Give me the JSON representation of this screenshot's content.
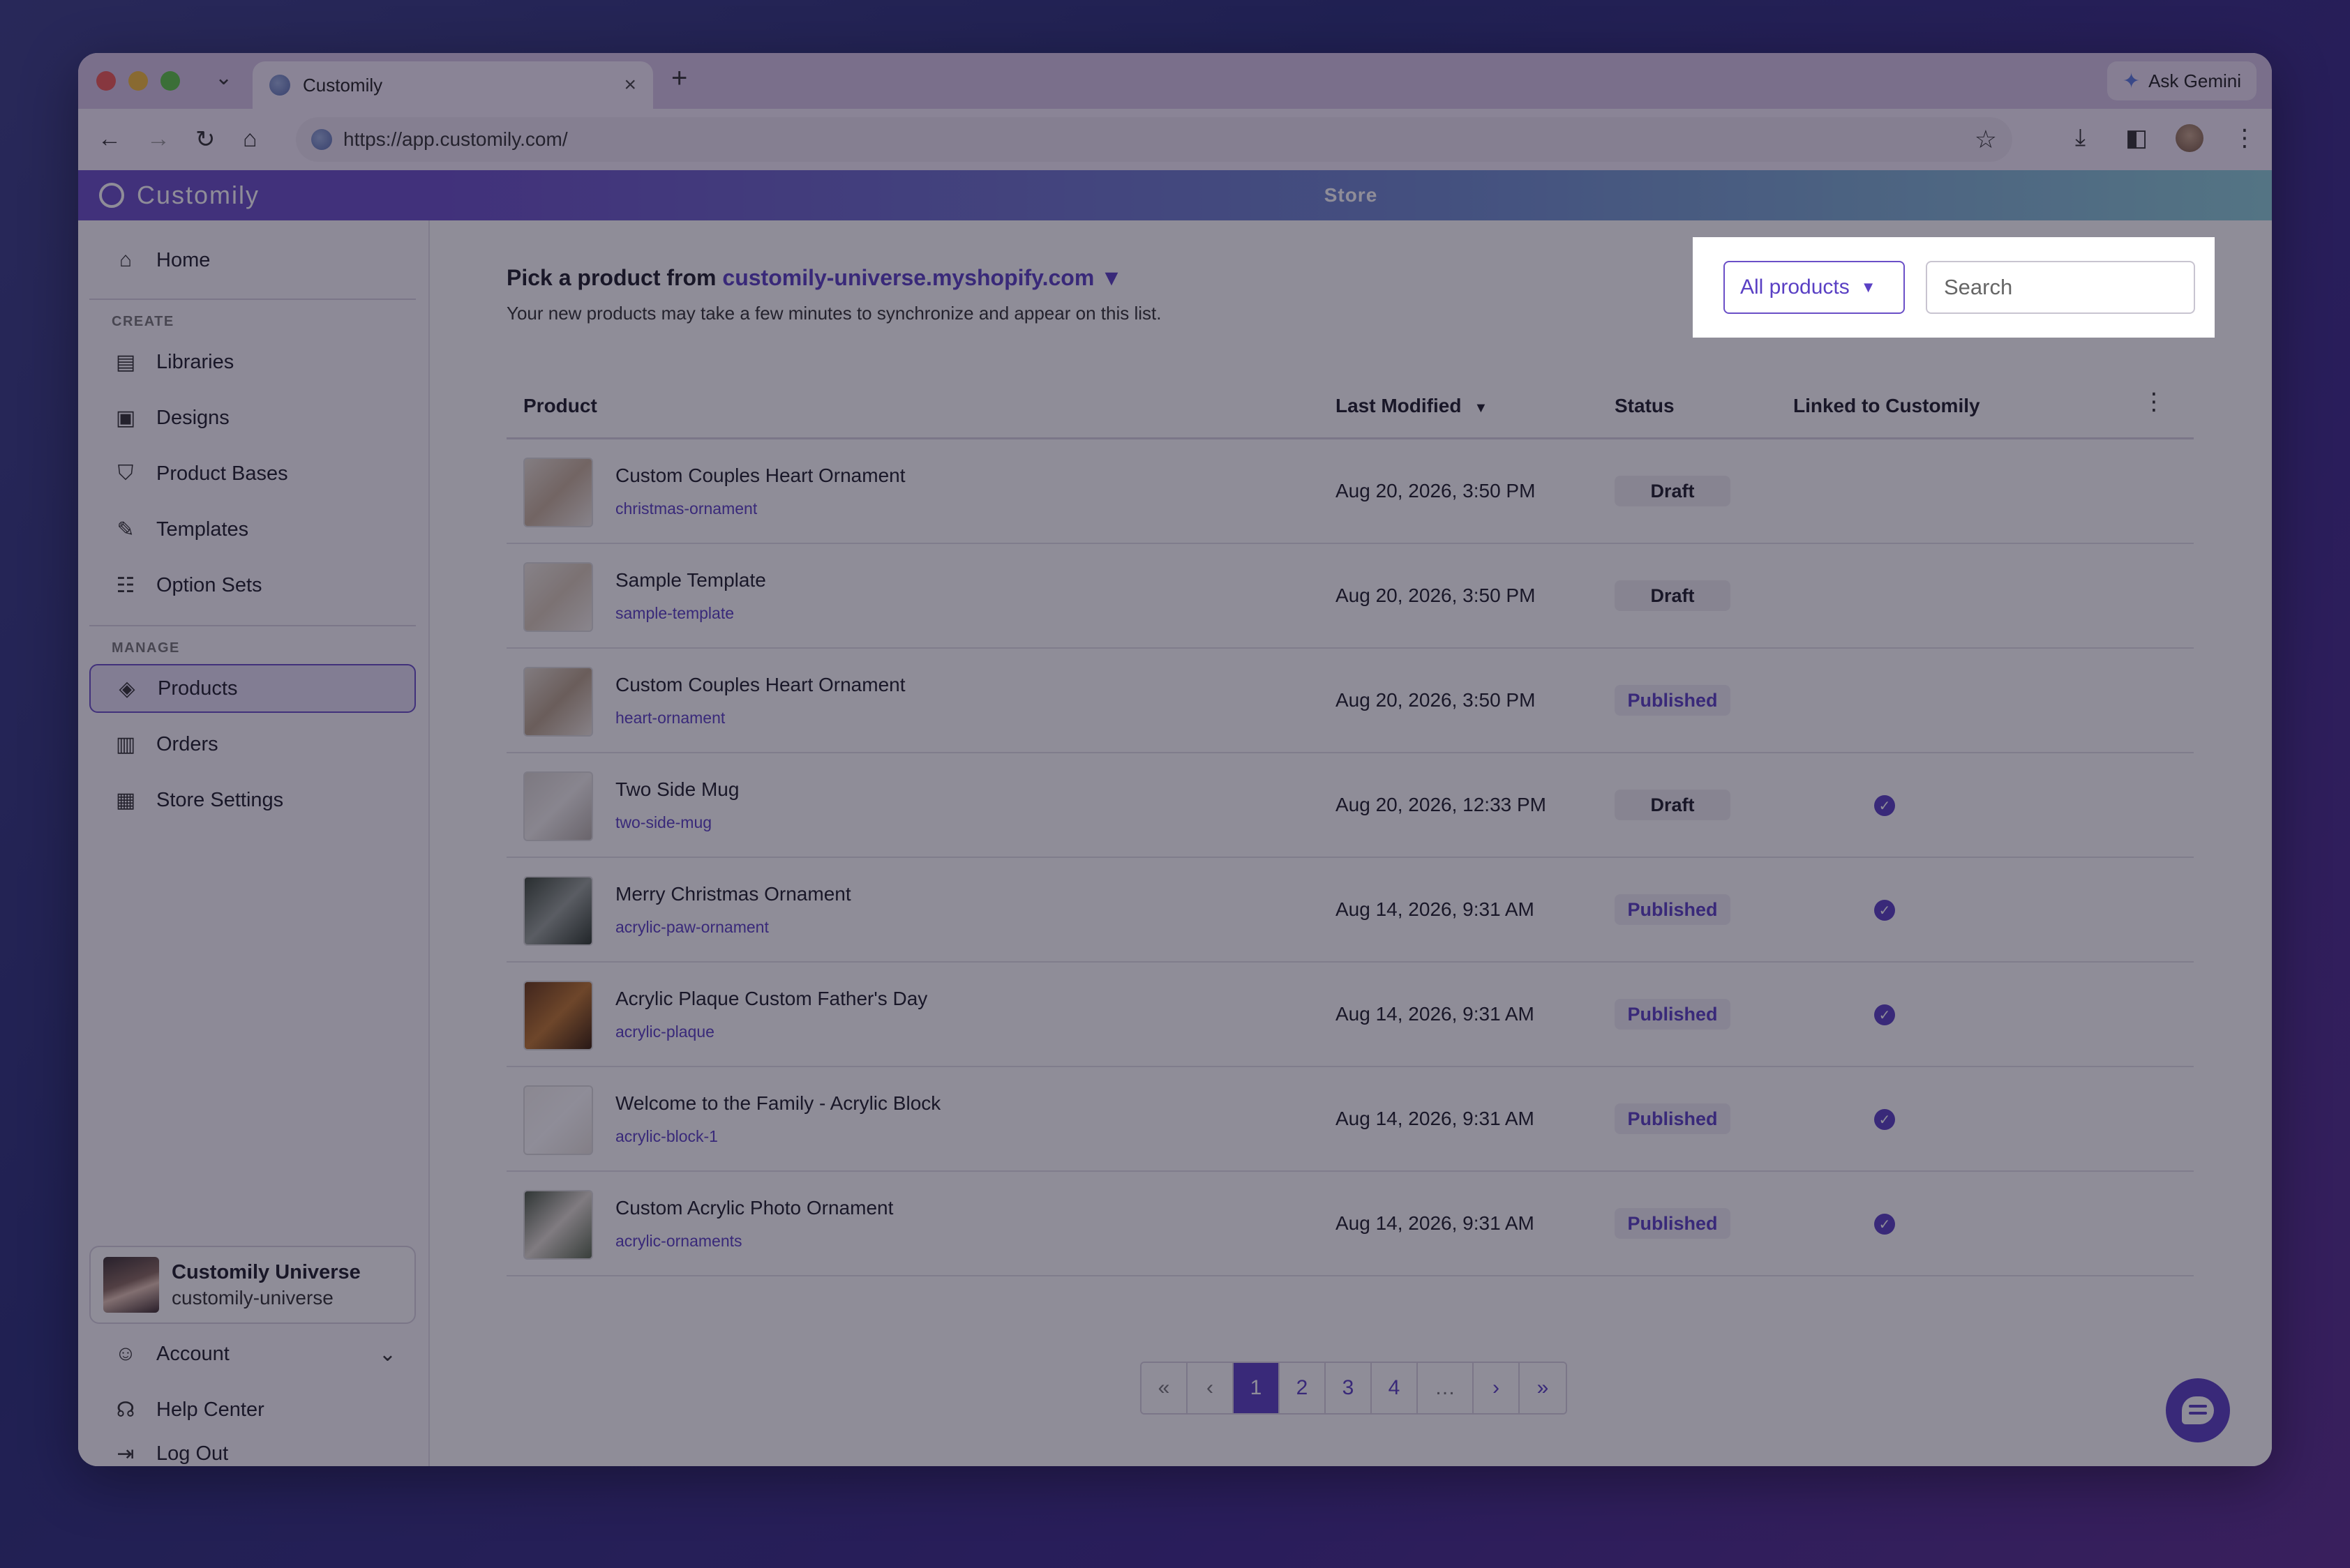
{
  "browser": {
    "tab_title": "Customily",
    "tab_close": "×",
    "new_tab": "+",
    "tab_dropdown": "⌄",
    "ask_gemini": "Ask Gemini",
    "url": "https://app.customily.com/"
  },
  "app": {
    "brand": "Customily",
    "store_header": "Store"
  },
  "sidebar": {
    "home": {
      "label": "Home",
      "icon": "home-icon"
    },
    "create_section": "CREATE",
    "create_items": [
      {
        "label": "Libraries",
        "icon": "libraries-icon"
      },
      {
        "label": "Designs",
        "icon": "designs-icon"
      },
      {
        "label": "Product Bases",
        "icon": "shirt-icon"
      },
      {
        "label": "Templates",
        "icon": "templates-icon"
      },
      {
        "label": "Option Sets",
        "icon": "option-sets-icon"
      }
    ],
    "manage_section": "MANAGE",
    "manage_items": [
      {
        "label": "Products",
        "icon": "tag-icon",
        "active": true
      },
      {
        "label": "Orders",
        "icon": "orders-icon"
      },
      {
        "label": "Store Settings",
        "icon": "store-icon"
      }
    ],
    "account_card": {
      "name": "Customily Universe",
      "handle": "customily-universe"
    },
    "bottom_items": [
      {
        "label": "Account",
        "icon": "user-circle-icon"
      },
      {
        "label": "Help Center",
        "icon": "headset-icon"
      },
      {
        "label": "Log Out",
        "icon": "logout-icon"
      }
    ]
  },
  "main": {
    "pick_prefix": "Pick a product from",
    "store_link": "customily-universe.myshopify.com ▼",
    "subtitle": "Your new products may take a few minutes to synchronize and appear on this list.",
    "filter": {
      "label": "All products",
      "caret": "▼"
    },
    "search": {
      "placeholder": "Search",
      "value": ""
    },
    "columns": {
      "product": "Product",
      "last_modified": "Last Modified",
      "status": "Status",
      "linked": "Linked to Customily"
    },
    "rows": [
      {
        "name": "Custom Couples Heart Ornament",
        "handle": "christmas-ornament",
        "modified": "Aug 20, 2026, 3:50 PM",
        "status": "Draft",
        "linked": false
      },
      {
        "name": "Sample Template",
        "handle": "sample-template",
        "modified": "Aug 20, 2026, 3:50 PM",
        "status": "Draft",
        "linked": false
      },
      {
        "name": "Custom Couples Heart Ornament",
        "handle": "heart-ornament",
        "modified": "Aug 20, 2026, 3:50 PM",
        "status": "Published",
        "linked": false
      },
      {
        "name": "Two Side Mug",
        "handle": "two-side-mug",
        "modified": "Aug 20, 2026, 12:33 PM",
        "status": "Draft",
        "linked": true
      },
      {
        "name": "Merry Christmas Ornament",
        "handle": "acrylic-paw-ornament",
        "modified": "Aug 14, 2026, 9:31 AM",
        "status": "Published",
        "linked": true
      },
      {
        "name": "Acrylic Plaque Custom Father's Day",
        "handle": "acrylic-plaque",
        "modified": "Aug 14, 2026, 9:31 AM",
        "status": "Published",
        "linked": true
      },
      {
        "name": "Welcome to the Family - Acrylic Block",
        "handle": "acrylic-block-1",
        "modified": "Aug 14, 2026, 9:31 AM",
        "status": "Published",
        "linked": true
      },
      {
        "name": "Custom Acrylic Photo Ornament",
        "handle": "acrylic-ornaments",
        "modified": "Aug 14, 2026, 9:31 AM",
        "status": "Published",
        "linked": true
      }
    ],
    "pagination": {
      "first": "«",
      "prev": "‹",
      "pages": [
        "1",
        "2",
        "3",
        "4"
      ],
      "current": "1",
      "ellipsis": "…",
      "next": "›",
      "last": "»"
    }
  },
  "colors": {
    "accent": "#5a40c4",
    "brand_bar": "#6a4fc7"
  }
}
